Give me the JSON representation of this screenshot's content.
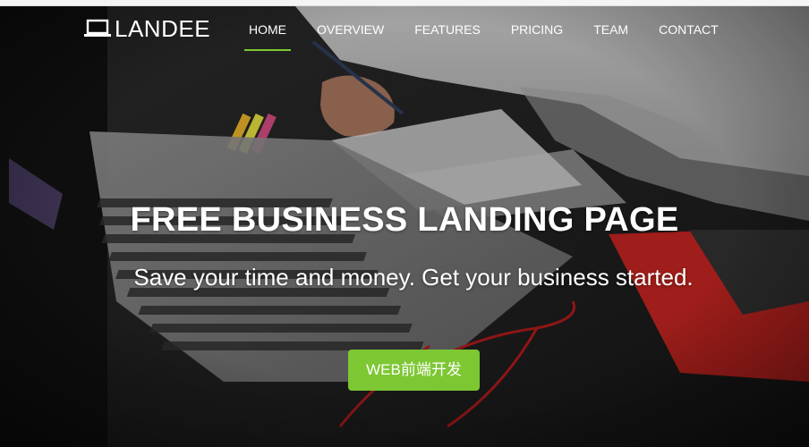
{
  "brand": {
    "icon": "laptop-icon",
    "name": "LANDEE"
  },
  "nav": {
    "items": [
      {
        "label": "HOME",
        "active": true
      },
      {
        "label": "OVERVIEW",
        "active": false
      },
      {
        "label": "FEATURES",
        "active": false
      },
      {
        "label": "PRICING",
        "active": false
      },
      {
        "label": "TEAM",
        "active": false
      },
      {
        "label": "CONTACT",
        "active": false
      }
    ]
  },
  "hero": {
    "title": "FREE BUSINESS LANDING PAGE",
    "subtitle": "Save your time and money. Get your business started.",
    "cta_label": "WEB前端开发"
  },
  "colors": {
    "accent": "#7dc733",
    "text": "#ffffff",
    "background": "#1e1e1e"
  }
}
